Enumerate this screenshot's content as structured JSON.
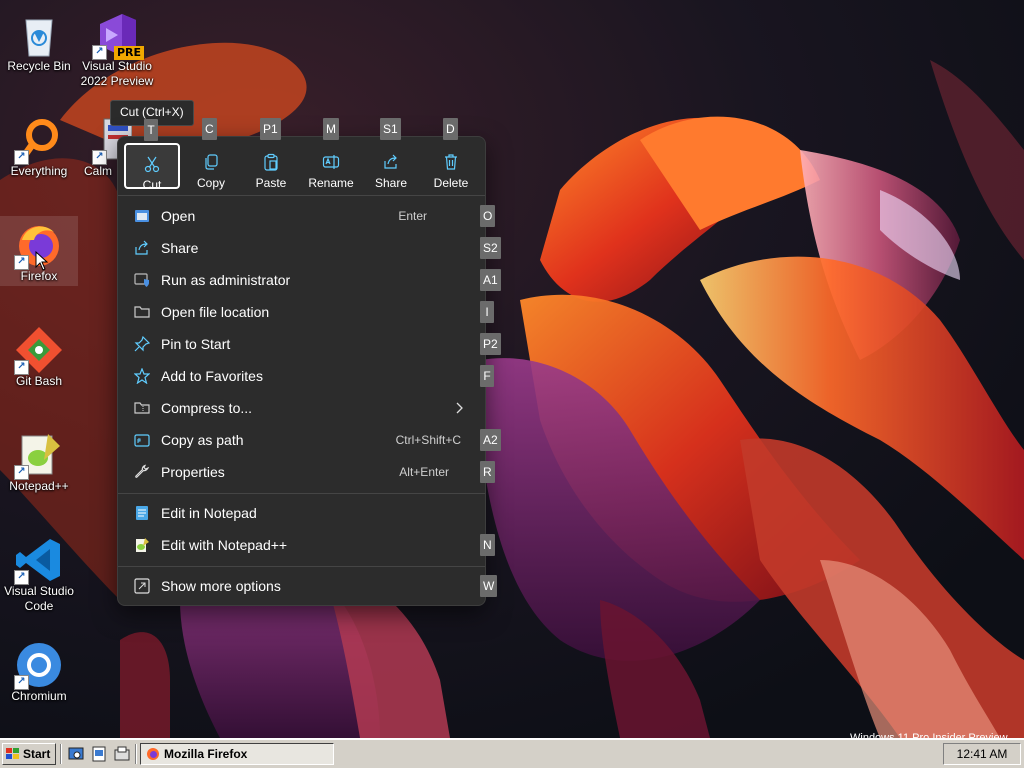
{
  "colors": {
    "menu_bg": "#2c2c2c",
    "accent": "#60cdff",
    "taskbar": "#d4d0c8"
  },
  "desktop_icons": [
    {
      "label": "Recycle Bin",
      "icon": "recycle-bin-icon"
    },
    {
      "label": "Visual Studio 2022 Preview",
      "icon": "visual-studio-icon",
      "badge": "PRE"
    },
    {
      "label": "Everything",
      "icon": "everything-search-icon"
    },
    {
      "label": "Calm",
      "icon": "calm-app-icon"
    },
    {
      "label": "Firefox",
      "icon": "firefox-icon"
    },
    {
      "label": "Git Bash",
      "icon": "git-bash-icon"
    },
    {
      "label": "Notepad++",
      "icon": "notepadpp-icon"
    },
    {
      "label": "Visual Studio Code",
      "icon": "vscode-icon"
    },
    {
      "label": "Chromium",
      "icon": "chromium-icon"
    }
  ],
  "tooltip": "Cut (Ctrl+X)",
  "toolbar": [
    {
      "label": "Cut",
      "key": "T",
      "icon": "scissors-icon"
    },
    {
      "label": "Copy",
      "key": "C",
      "icon": "copy-icon"
    },
    {
      "label": "Paste",
      "key": "P1",
      "icon": "paste-icon"
    },
    {
      "label": "Rename",
      "key": "M",
      "icon": "rename-icon"
    },
    {
      "label": "Share",
      "key": "S1",
      "icon": "share-icon"
    },
    {
      "label": "Delete",
      "key": "D",
      "icon": "trash-icon"
    }
  ],
  "menu_items": [
    {
      "label": "Open",
      "shortcut": "Enter",
      "key": "O",
      "icon": "open-icon"
    },
    {
      "label": "Share",
      "shortcut": "",
      "key": "S2",
      "icon": "share-icon"
    },
    {
      "label": "Run as administrator",
      "shortcut": "",
      "key": "A1",
      "icon": "shield-icon"
    },
    {
      "label": "Open file location",
      "shortcut": "",
      "key": "I",
      "icon": "folder-icon"
    },
    {
      "label": "Pin to Start",
      "shortcut": "",
      "key": "P2",
      "icon": "pin-icon"
    },
    {
      "label": "Add to Favorites",
      "shortcut": "",
      "key": "F",
      "icon": "star-icon"
    },
    {
      "label": "Compress to...",
      "shortcut": "",
      "key": "",
      "icon": "zip-icon"
    },
    {
      "label": "Copy as path",
      "shortcut": "Ctrl+Shift+C",
      "key": "A2",
      "icon": "copy-path-icon"
    },
    {
      "label": "Properties",
      "shortcut": "Alt+Enter",
      "key": "R",
      "icon": "wrench-icon"
    },
    {
      "label": "Edit in Notepad",
      "shortcut": "",
      "key": "",
      "icon": "notepad-icon"
    },
    {
      "label": "Edit with Notepad++",
      "shortcut": "",
      "key": "N",
      "icon": "notepadpp-icon"
    },
    {
      "label": "Show more options",
      "shortcut": "",
      "key": "W",
      "icon": "more-options-icon"
    }
  ],
  "taskbar": {
    "start_label": "Start",
    "task_label": "Mozilla Firefox",
    "clock": "12:41 AM",
    "quick_launch": [
      "show-desktop-icon",
      "explorer-icon",
      "command-icon"
    ]
  },
  "watermark": "Windows 11 Pro Insider Preview"
}
